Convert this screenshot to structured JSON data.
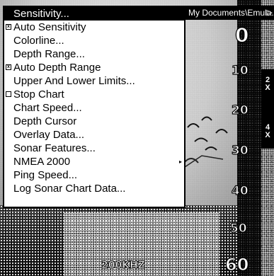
{
  "window": {
    "title": "My Documents\\Emula...",
    "title_arrow": "▷"
  },
  "menu": {
    "items": [
      {
        "label": "Sensitivity...",
        "selected": true,
        "checkbox": null,
        "submenu": false
      },
      {
        "label": "Auto Sensitivity",
        "selected": false,
        "checkbox": "checked",
        "submenu": false
      },
      {
        "label": "Colorline...",
        "selected": false,
        "checkbox": null,
        "submenu": false
      },
      {
        "label": "Depth Range...",
        "selected": false,
        "checkbox": null,
        "submenu": false
      },
      {
        "label": "Auto Depth Range",
        "selected": false,
        "checkbox": "checked",
        "submenu": false
      },
      {
        "label": "Upper And Lower Limits...",
        "selected": false,
        "checkbox": null,
        "submenu": false
      },
      {
        "label": "Stop Chart",
        "selected": false,
        "checkbox": "unchecked",
        "submenu": false
      },
      {
        "label": "Chart Speed...",
        "selected": false,
        "checkbox": null,
        "submenu": false
      },
      {
        "label": "Depth Cursor",
        "selected": false,
        "checkbox": null,
        "submenu": false
      },
      {
        "label": "Overlay Data...",
        "selected": false,
        "checkbox": null,
        "submenu": false
      },
      {
        "label": "Sonar Features...",
        "selected": false,
        "checkbox": null,
        "submenu": false
      },
      {
        "label": "NMEA 2000",
        "selected": false,
        "checkbox": null,
        "submenu": true
      },
      {
        "label": "Ping Speed...",
        "selected": false,
        "checkbox": null,
        "submenu": false
      },
      {
        "label": "Log Sonar Chart Data...",
        "selected": false,
        "checkbox": null,
        "submenu": false
      }
    ],
    "submenu_arrow": "▸",
    "check_mark": "x"
  },
  "zoom_bar": {
    "top": "2\nX",
    "bottom": "4\nX"
  },
  "depth_scale": [
    "0",
    "10",
    "20",
    "30",
    "40",
    "50",
    "60"
  ],
  "frequency": "200KHZ"
}
